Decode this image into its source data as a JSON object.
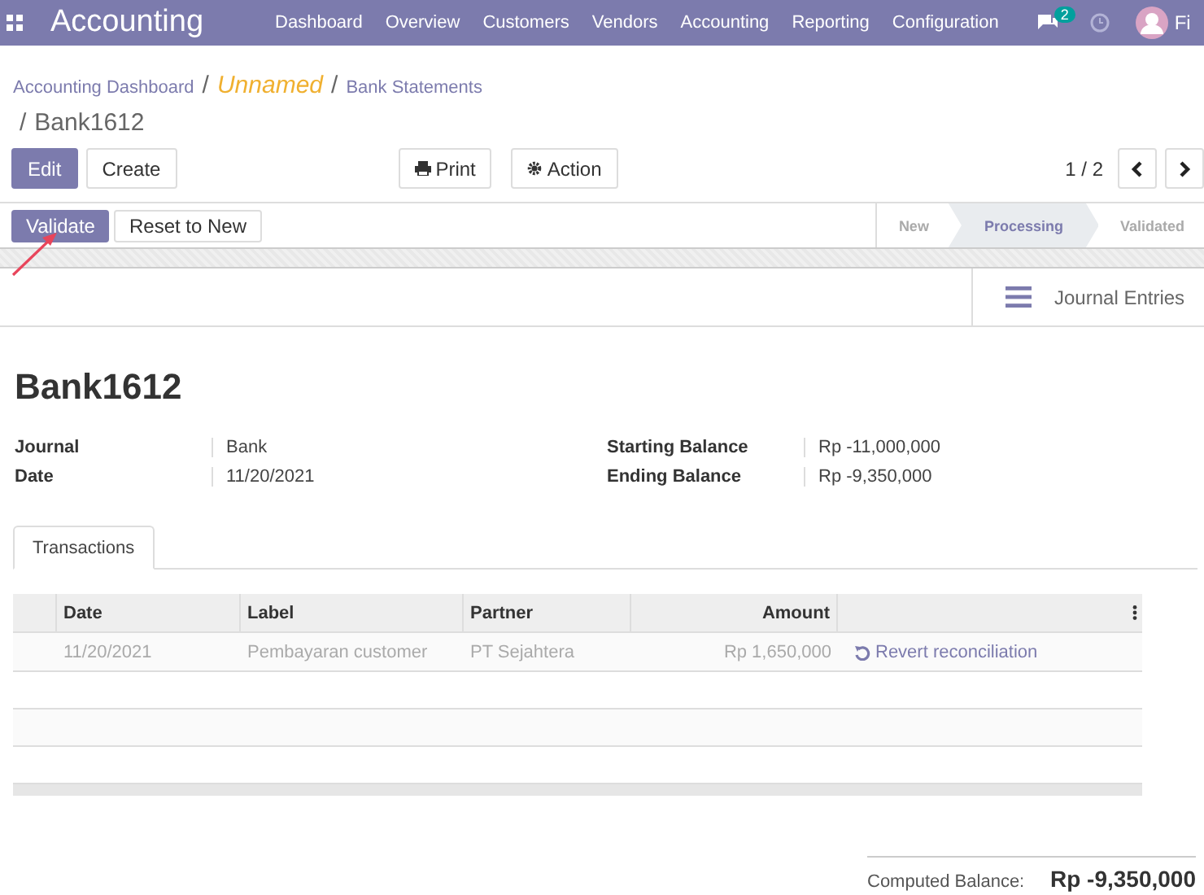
{
  "navbar": {
    "app_title": "Accounting",
    "menu": [
      {
        "label": "Dashboard"
      },
      {
        "label": "Overview"
      },
      {
        "label": "Customers"
      },
      {
        "label": "Vendors"
      },
      {
        "label": "Accounting"
      },
      {
        "label": "Reporting"
      },
      {
        "label": "Configuration"
      }
    ],
    "message_count": "2",
    "user_name": "Fi"
  },
  "breadcrumb": [
    {
      "label": "Accounting Dashboard",
      "kind": "link"
    },
    {
      "separator": "/",
      "label": "Unnamed",
      "kind": "unnamed"
    },
    {
      "separator": "/",
      "label": "Bank Statements",
      "kind": "link"
    },
    {
      "separator": "/",
      "label": "Bank1612",
      "kind": "current"
    }
  ],
  "buttons": {
    "edit": "Edit",
    "create": "Create",
    "print": "Print",
    "action": "Action"
  },
  "pager": "1 / 2",
  "statusbar_buttons": [
    {
      "label": "Validate",
      "kind": "primary"
    },
    {
      "label": "Reset to New",
      "kind": "secondary"
    }
  ],
  "stages": [
    {
      "label": "New",
      "selected": false
    },
    {
      "label": "Processing",
      "selected": true
    },
    {
      "label": "Validated",
      "selected": false
    }
  ],
  "smart_button": "Journal Entries",
  "record_title": "Bank1612",
  "fields_left": [
    {
      "label": "Journal",
      "value": "Bank"
    },
    {
      "label": "Date",
      "value": "11/20/2021"
    }
  ],
  "fields_right": [
    {
      "label": "Starting Balance",
      "value": "Rp -11,000,000"
    },
    {
      "label": "Ending Balance",
      "value": "Rp -9,350,000"
    }
  ],
  "tabs": [
    {
      "label": "Transactions",
      "selected": true
    }
  ],
  "table": {
    "columns": [
      "Date",
      "Label",
      "Partner",
      "Amount"
    ],
    "rows": [
      {
        "date": "11/20/2021",
        "label": "Pembayaran customer",
        "partner": "PT Sejahtera",
        "amount": "Rp 1,650,000",
        "action": "Revert reconciliation"
      }
    ]
  },
  "computed_balance": {
    "label": "Computed Balance:",
    "value": "Rp -9,350,000"
  }
}
